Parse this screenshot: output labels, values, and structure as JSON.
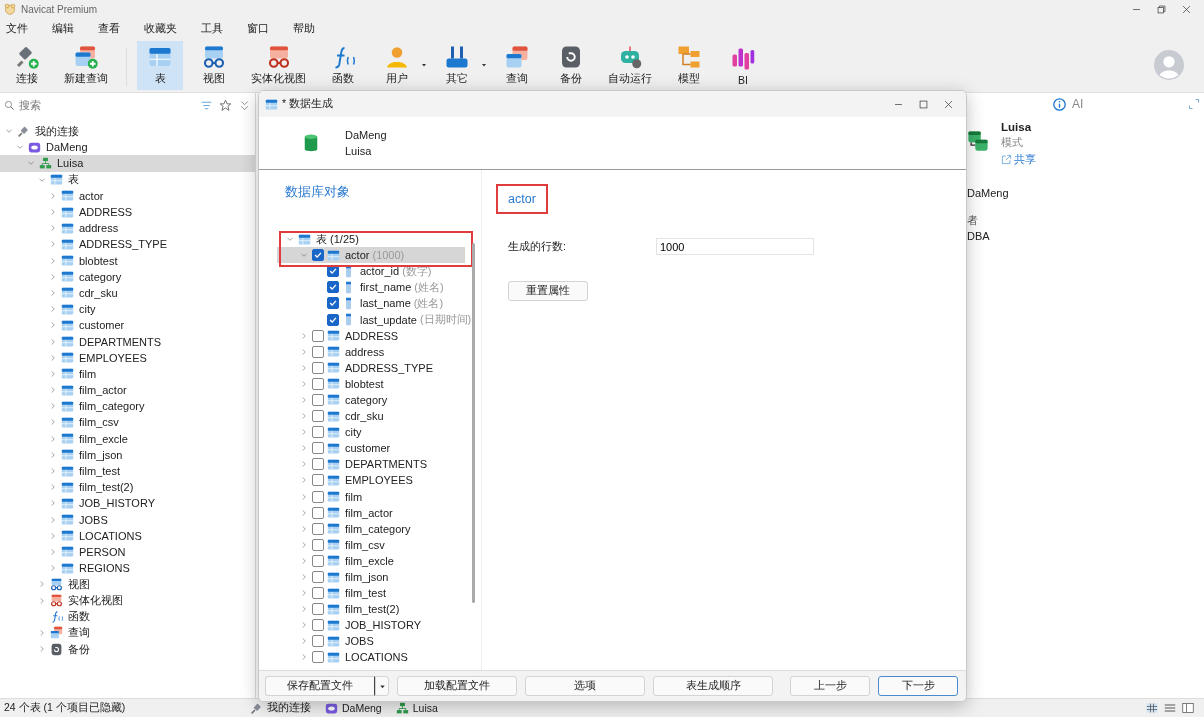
{
  "app": {
    "title": "Navicat Premium"
  },
  "menu": [
    "文件",
    "编辑",
    "查看",
    "收藏夹",
    "工具",
    "窗口",
    "帮助"
  ],
  "toolbar": [
    {
      "label": "连接",
      "kind": "connect",
      "selected": false,
      "has_menu": false
    },
    {
      "label": "新建查询",
      "kind": "newquery",
      "selected": false,
      "has_menu": false
    },
    {
      "label": "表",
      "kind": "table",
      "selected": true,
      "has_menu": false
    },
    {
      "label": "视图",
      "kind": "view",
      "selected": false,
      "has_menu": false
    },
    {
      "label": "实体化视图",
      "kind": "matview",
      "selected": false,
      "has_menu": false
    },
    {
      "label": "函数",
      "kind": "function",
      "selected": false,
      "has_menu": false
    },
    {
      "label": "用户",
      "kind": "user",
      "selected": false,
      "has_menu": true
    },
    {
      "label": "其它",
      "kind": "other",
      "selected": false,
      "has_menu": true
    },
    {
      "label": "查询",
      "kind": "query",
      "selected": false,
      "has_menu": false
    },
    {
      "label": "备份",
      "kind": "backup",
      "selected": false,
      "has_menu": false
    },
    {
      "label": "自动运行",
      "kind": "autorun",
      "selected": false,
      "has_menu": false
    },
    {
      "label": "模型",
      "kind": "model",
      "selected": false,
      "has_menu": false
    },
    {
      "label": "BI",
      "kind": "bi",
      "selected": false,
      "has_menu": false
    }
  ],
  "sidebar": {
    "search": {
      "placeholder": "搜索"
    },
    "tree": [
      {
        "label": "我的连接",
        "kind": "connection-group",
        "expanded": true,
        "selected": false,
        "children": [
          {
            "label": "DaMeng",
            "kind": "server",
            "expanded": true,
            "selected": false,
            "children": [
              {
                "label": "Luisa",
                "kind": "schema",
                "expanded": true,
                "selected": true,
                "children": [
                  {
                    "label": "表",
                    "kind": "tables",
                    "expanded": true,
                    "selected": false,
                    "children": [
                      {
                        "label": "actor",
                        "kind": "table",
                        "expanded": false,
                        "selected": false
                      },
                      {
                        "label": "ADDRESS",
                        "kind": "table",
                        "expanded": false,
                        "selected": false
                      },
                      {
                        "label": "address",
                        "kind": "table",
                        "expanded": false,
                        "selected": false
                      },
                      {
                        "label": "ADDRESS_TYPE",
                        "kind": "table",
                        "expanded": false,
                        "selected": false
                      },
                      {
                        "label": "blobtest",
                        "kind": "table",
                        "expanded": false,
                        "selected": false
                      },
                      {
                        "label": "category",
                        "kind": "table",
                        "expanded": false,
                        "selected": false
                      },
                      {
                        "label": "cdr_sku",
                        "kind": "table",
                        "expanded": false,
                        "selected": false
                      },
                      {
                        "label": "city",
                        "kind": "table",
                        "expanded": false,
                        "selected": false
                      },
                      {
                        "label": "customer",
                        "kind": "table",
                        "expanded": false,
                        "selected": false
                      },
                      {
                        "label": "DEPARTMENTS",
                        "kind": "table",
                        "expanded": false,
                        "selected": false
                      },
                      {
                        "label": "EMPLOYEES",
                        "kind": "table",
                        "expanded": false,
                        "selected": false
                      },
                      {
                        "label": "film",
                        "kind": "table",
                        "expanded": false,
                        "selected": false
                      },
                      {
                        "label": "film_actor",
                        "kind": "table",
                        "expanded": false,
                        "selected": false
                      },
                      {
                        "label": "film_category",
                        "kind": "table",
                        "expanded": false,
                        "selected": false
                      },
                      {
                        "label": "film_csv",
                        "kind": "table",
                        "expanded": false,
                        "selected": false
                      },
                      {
                        "label": "film_excle",
                        "kind": "table",
                        "expanded": false,
                        "selected": false
                      },
                      {
                        "label": "film_json",
                        "kind": "table",
                        "expanded": false,
                        "selected": false
                      },
                      {
                        "label": "film_test",
                        "kind": "table",
                        "expanded": false,
                        "selected": false
                      },
                      {
                        "label": "film_test(2)",
                        "kind": "table",
                        "expanded": false,
                        "selected": false
                      },
                      {
                        "label": "JOB_HISTORY",
                        "kind": "table",
                        "expanded": false,
                        "selected": false
                      },
                      {
                        "label": "JOBS",
                        "kind": "table",
                        "expanded": false,
                        "selected": false
                      },
                      {
                        "label": "LOCATIONS",
                        "kind": "table",
                        "expanded": false,
                        "selected": false
                      },
                      {
                        "label": "PERSON",
                        "kind": "table",
                        "expanded": false,
                        "selected": false
                      },
                      {
                        "label": "REGIONS",
                        "kind": "table",
                        "expanded": false,
                        "selected": false
                      }
                    ]
                  },
                  {
                    "label": "视图",
                    "kind": "views",
                    "expanded": false,
                    "selected": false
                  },
                  {
                    "label": "实体化视图",
                    "kind": "matviews",
                    "expanded": false,
                    "selected": false
                  },
                  {
                    "label": "函数",
                    "kind": "functions",
                    "selected": false
                  },
                  {
                    "label": "查询",
                    "kind": "queries",
                    "expanded": false,
                    "selected": false
                  },
                  {
                    "label": "备份",
                    "kind": "backups",
                    "expanded": false,
                    "selected": false
                  }
                ]
              }
            ]
          }
        ]
      }
    ]
  },
  "info_panel": {
    "ai": "AI",
    "name": "Luisa",
    "type": "模式",
    "share": "共享",
    "connection": "DaMeng",
    "owner_label": "者",
    "owner": "DBA"
  },
  "status_bar": {
    "summary": "24 个表 (1 个项目已隐藏)",
    "path": [
      {
        "label": "我的连接",
        "kind": "connection-group"
      },
      {
        "label": "DaMeng",
        "kind": "server"
      },
      {
        "label": "Luisa",
        "kind": "schema"
      }
    ]
  },
  "dialog": {
    "title": "* 数据生成",
    "connection": "DaMeng",
    "schema": "Luisa",
    "objects_heading": "数据库对象",
    "tree": {
      "label": "表",
      "count": "(1/25)",
      "expanded": true,
      "highlighted": true,
      "tables": [
        {
          "name": "actor",
          "note": "(1000)",
          "checked": true,
          "selected": true,
          "expanded": true,
          "fields": [
            {
              "name": "actor_id",
              "type": "(数字)",
              "checked": true
            },
            {
              "name": "first_name",
              "type": "(姓名)",
              "checked": true
            },
            {
              "name": "last_name",
              "type": "(姓名)",
              "checked": true
            },
            {
              "name": "last_update",
              "type": "(日期时间)",
              "checked": true
            }
          ]
        },
        {
          "name": "ADDRESS",
          "checked": false,
          "selected": false,
          "expanded": false
        },
        {
          "name": "address",
          "checked": false,
          "selected": false,
          "expanded": false
        },
        {
          "name": "ADDRESS_TYPE",
          "checked": false,
          "selected": false,
          "expanded": false
        },
        {
          "name": "blobtest",
          "checked": false,
          "selected": false,
          "expanded": false
        },
        {
          "name": "category",
          "checked": false,
          "selected": false,
          "expanded": false
        },
        {
          "name": "cdr_sku",
          "checked": false,
          "selected": false,
          "expanded": false
        },
        {
          "name": "city",
          "checked": false,
          "selected": false,
          "expanded": false
        },
        {
          "name": "customer",
          "checked": false,
          "selected": false,
          "expanded": false
        },
        {
          "name": "DEPARTMENTS",
          "checked": false,
          "selected": false,
          "expanded": false
        },
        {
          "name": "EMPLOYEES",
          "checked": false,
          "selected": false,
          "expanded": false
        },
        {
          "name": "film",
          "checked": false,
          "selected": false,
          "expanded": false
        },
        {
          "name": "film_actor",
          "checked": false,
          "selected": false,
          "expanded": false
        },
        {
          "name": "film_category",
          "checked": false,
          "selected": false,
          "expanded": false
        },
        {
          "name": "film_csv",
          "checked": false,
          "selected": false,
          "expanded": false
        },
        {
          "name": "film_excle",
          "checked": false,
          "selected": false,
          "expanded": false
        },
        {
          "name": "film_json",
          "checked": false,
          "selected": false,
          "expanded": false
        },
        {
          "name": "film_test",
          "checked": false,
          "selected": false,
          "expanded": false
        },
        {
          "name": "film_test(2)",
          "checked": false,
          "selected": false,
          "expanded": false
        },
        {
          "name": "JOB_HISTORY",
          "checked": false,
          "selected": false,
          "expanded": false
        },
        {
          "name": "JOBS",
          "checked": false,
          "selected": false,
          "expanded": false
        },
        {
          "name": "LOCATIONS",
          "checked": false,
          "selected": false,
          "expanded": false
        }
      ]
    },
    "detail": {
      "title": "actor",
      "highlighted": true,
      "rows_label": "生成的行数:",
      "rows_value": "1000",
      "reset": "重置属性"
    },
    "buttons": [
      {
        "label": "保存配置文件",
        "kind": "split"
      },
      {
        "label": "加载配置文件",
        "kind": "action"
      },
      {
        "label": "选项",
        "kind": "action"
      },
      {
        "label": "表生成顺序",
        "kind": "action"
      },
      {
        "label": "上一步",
        "kind": "nav"
      },
      {
        "label": "下一步",
        "kind": "default"
      }
    ]
  }
}
